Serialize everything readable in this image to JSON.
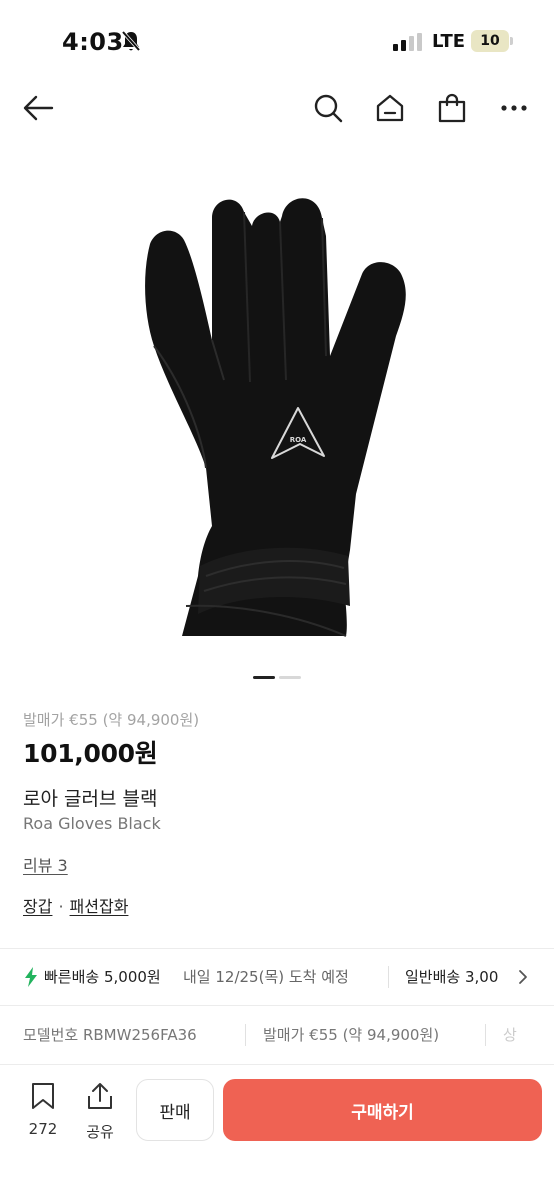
{
  "status_bar": {
    "time": "4:03",
    "network": "LTE",
    "battery": "10"
  },
  "product": {
    "release_price": "발매가 €55 (약 94,900원)",
    "price": "101,000원",
    "name_ko": "로아 글러브 블랙",
    "name_en": "Roa Gloves Black",
    "review": "리뷰 3",
    "category_1": "장갑",
    "category_sep": "·",
    "category_2": "패션잡화",
    "logo_text": "ROA"
  },
  "delivery": {
    "fast_label": "빠른배송 5,000원",
    "fast_eta": "내일 12/25(목) 도착 예정",
    "normal_label": "일반배송 3,00"
  },
  "specs": {
    "model": "모델번호 RBMW256FA36",
    "release": "발매가 €55 (약 94,900원)",
    "more": "상"
  },
  "bottom_bar": {
    "wish_count": "272",
    "share_label": "공유",
    "sell_label": "판매",
    "buy_label": "구매하기"
  },
  "colors": {
    "buy_button": "#ef6253",
    "bolt": "#22b35e"
  },
  "icons": [
    "back-arrow-icon",
    "search-icon",
    "home-icon",
    "shopping-bag-icon",
    "more-icon",
    "bolt-icon",
    "chevron-right-icon",
    "bookmark-icon",
    "share-icon"
  ]
}
